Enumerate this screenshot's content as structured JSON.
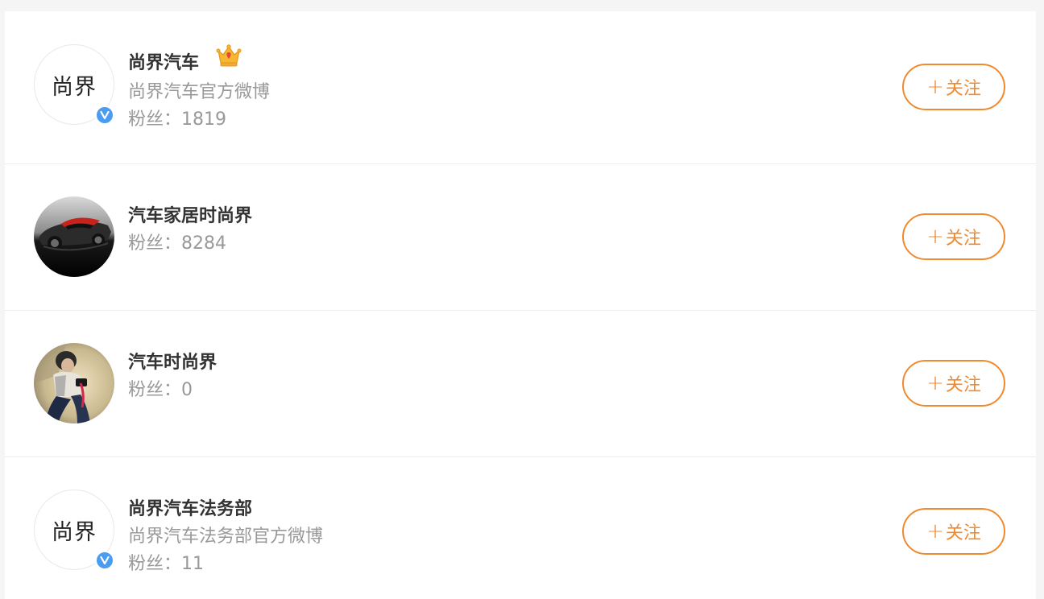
{
  "results": [
    {
      "avatar_text": "尚界",
      "avatar_type": "text",
      "verified": true,
      "vip_crown": true,
      "name": "尚界汽车",
      "description": "尚界汽车官方微博",
      "fans_label": "粉丝：",
      "fans_count": "1819",
      "follow_plus": "+",
      "follow_label": "关注"
    },
    {
      "avatar_type": "car-photo",
      "verified": false,
      "vip_crown": false,
      "name": "汽车家居时尚界",
      "fans_label": "粉丝：",
      "fans_count": "8284",
      "follow_plus": "+",
      "follow_label": "关注"
    },
    {
      "avatar_type": "person-photo",
      "verified": false,
      "vip_crown": false,
      "name": "汽车时尚界",
      "fans_label": "粉丝：",
      "fans_count": "0",
      "follow_plus": "+",
      "follow_label": "关注"
    },
    {
      "avatar_text": "尚界",
      "avatar_type": "text",
      "verified": true,
      "vip_crown": false,
      "name": "尚界汽车法务部",
      "description": "尚界汽车法务部官方微博",
      "fans_label": "粉丝：",
      "fans_count": "11",
      "follow_plus": "+",
      "follow_label": "关注"
    }
  ],
  "colors": {
    "accent": "#f08a2e",
    "verified_badge": "#4a9cf0",
    "name_text": "#333333",
    "secondary_text": "#999999",
    "divider": "#ededed"
  },
  "icons": {
    "verified": "verified-v-icon",
    "crown": "vip-crown-icon",
    "plus": "plus-icon"
  }
}
